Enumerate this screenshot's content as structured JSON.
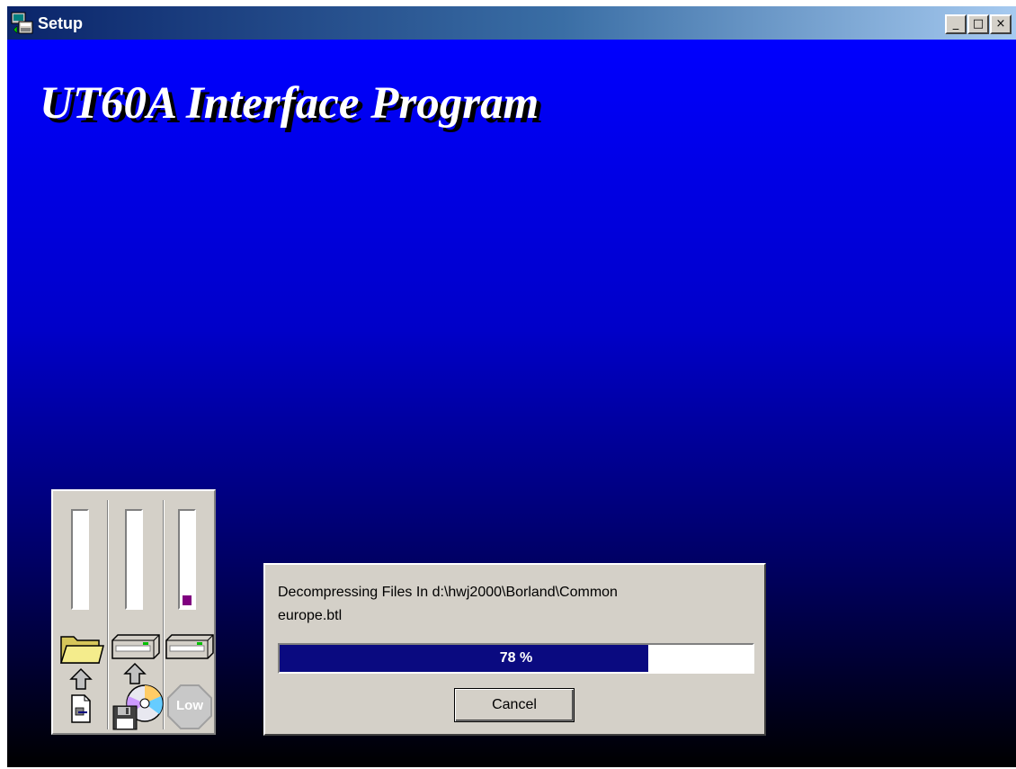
{
  "window": {
    "title": "Setup",
    "controls": {
      "minimize": "_",
      "maximize": "□",
      "close": "×"
    }
  },
  "installer": {
    "heading": "UT60A Interface Program",
    "meters": {
      "gauges": [
        {
          "name": "source-files",
          "level": 0
        },
        {
          "name": "destination-disk",
          "level": 0
        },
        {
          "name": "disk-space",
          "level": 0.1
        }
      ],
      "low_label": "Low",
      "icons": [
        "folder-icon",
        "up-arrow-icon",
        "document-icon",
        "disk-drive-icon",
        "cd-disk-icon",
        "floppy-icon",
        "low-stop-icon"
      ],
      "fill_color": "#800080"
    }
  },
  "dialog": {
    "status_line": "Decompressing Files In d:\\hwj2000\\Borland\\Common",
    "file_line": "europe.btl",
    "progress_percent": 78,
    "progress_label": "78 %",
    "cancel_label": "Cancel",
    "progress_color": "#0a0a80"
  },
  "colors": {
    "title_start": "#0a246a",
    "title_end": "#a6caf0",
    "background_top": "#0000ff",
    "background_bottom": "#000000",
    "chrome": "#d4d0c8"
  }
}
